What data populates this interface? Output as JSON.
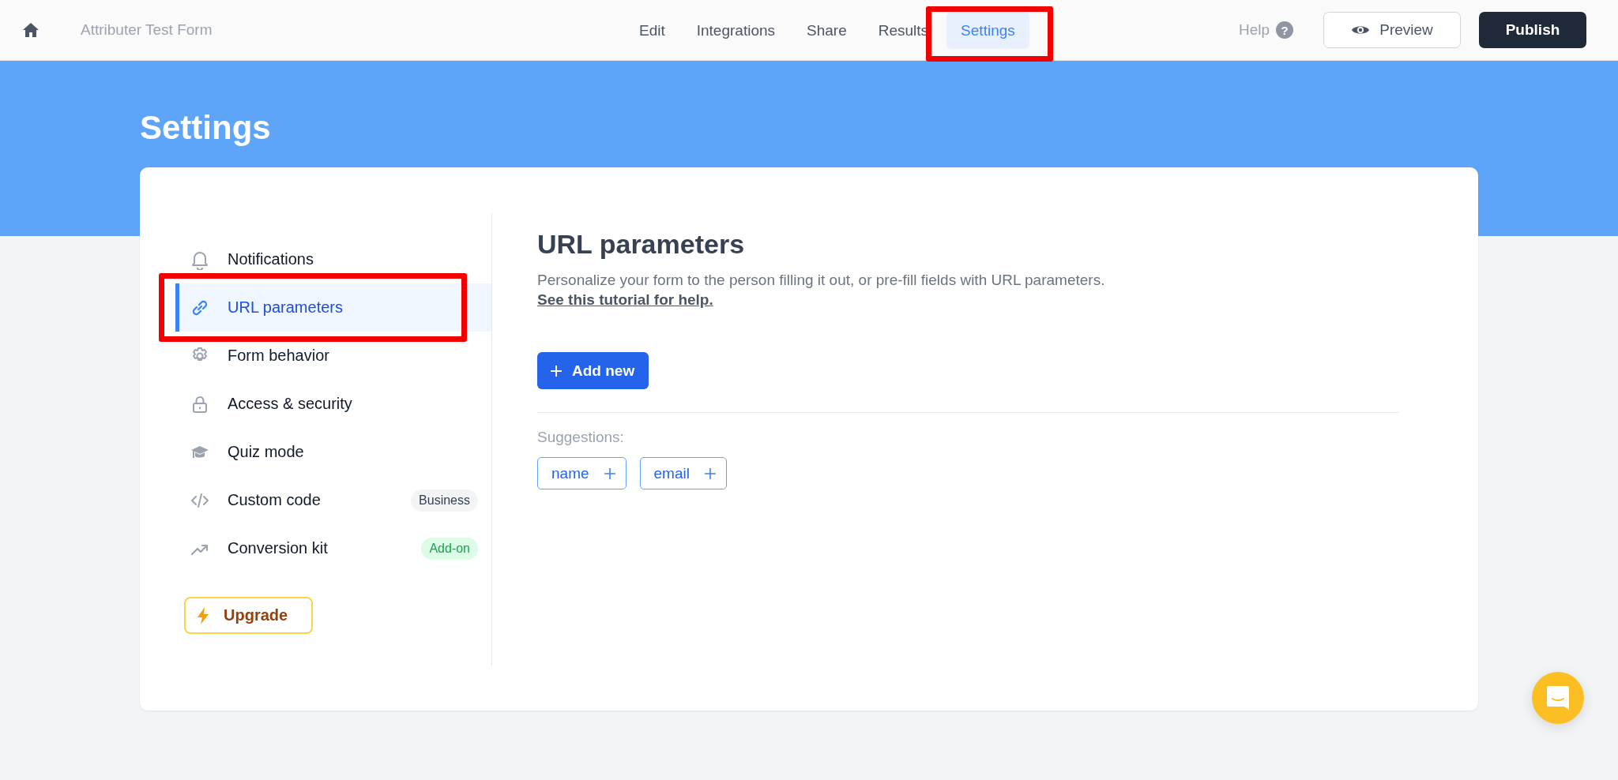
{
  "topbar": {
    "form_title": "Attributer Test Form",
    "tabs": [
      {
        "label": "Edit",
        "selected": false,
        "highlighted": false
      },
      {
        "label": "Integrations",
        "selected": false,
        "highlighted": false
      },
      {
        "label": "Share",
        "selected": false,
        "highlighted": false
      },
      {
        "label": "Results",
        "selected": false,
        "highlighted": false
      },
      {
        "label": "Settings",
        "selected": true,
        "highlighted": true
      }
    ],
    "help": "Help",
    "help_icon": "?",
    "preview": "Preview",
    "publish": "Publish"
  },
  "page_title": "Settings",
  "sidebar": {
    "items": [
      {
        "label": "Notifications",
        "selected": false,
        "highlighted": false
      },
      {
        "label": "URL parameters",
        "selected": true,
        "highlighted": true
      },
      {
        "label": "Form behavior",
        "selected": false,
        "highlighted": false
      },
      {
        "label": "Access & security",
        "selected": false,
        "highlighted": false
      },
      {
        "label": "Quiz mode",
        "selected": false,
        "highlighted": false
      },
      {
        "label": "Custom code",
        "selected": false,
        "highlighted": false,
        "badge": {
          "text": "Business",
          "kind": "plan"
        }
      },
      {
        "label": "Conversion kit",
        "selected": false,
        "highlighted": false,
        "badge": {
          "text": "Add-on",
          "kind": "addon"
        }
      }
    ],
    "upgrade": "Upgrade"
  },
  "panel": {
    "title": "URL parameters",
    "description": "Personalize your form to the person filling it out, or pre-fill fields with URL parameters.",
    "link": "See this tutorial for help.",
    "add_button": "Add new",
    "suggestions_label": "Suggestions:",
    "suggestions": [
      "name",
      "email"
    ]
  }
}
